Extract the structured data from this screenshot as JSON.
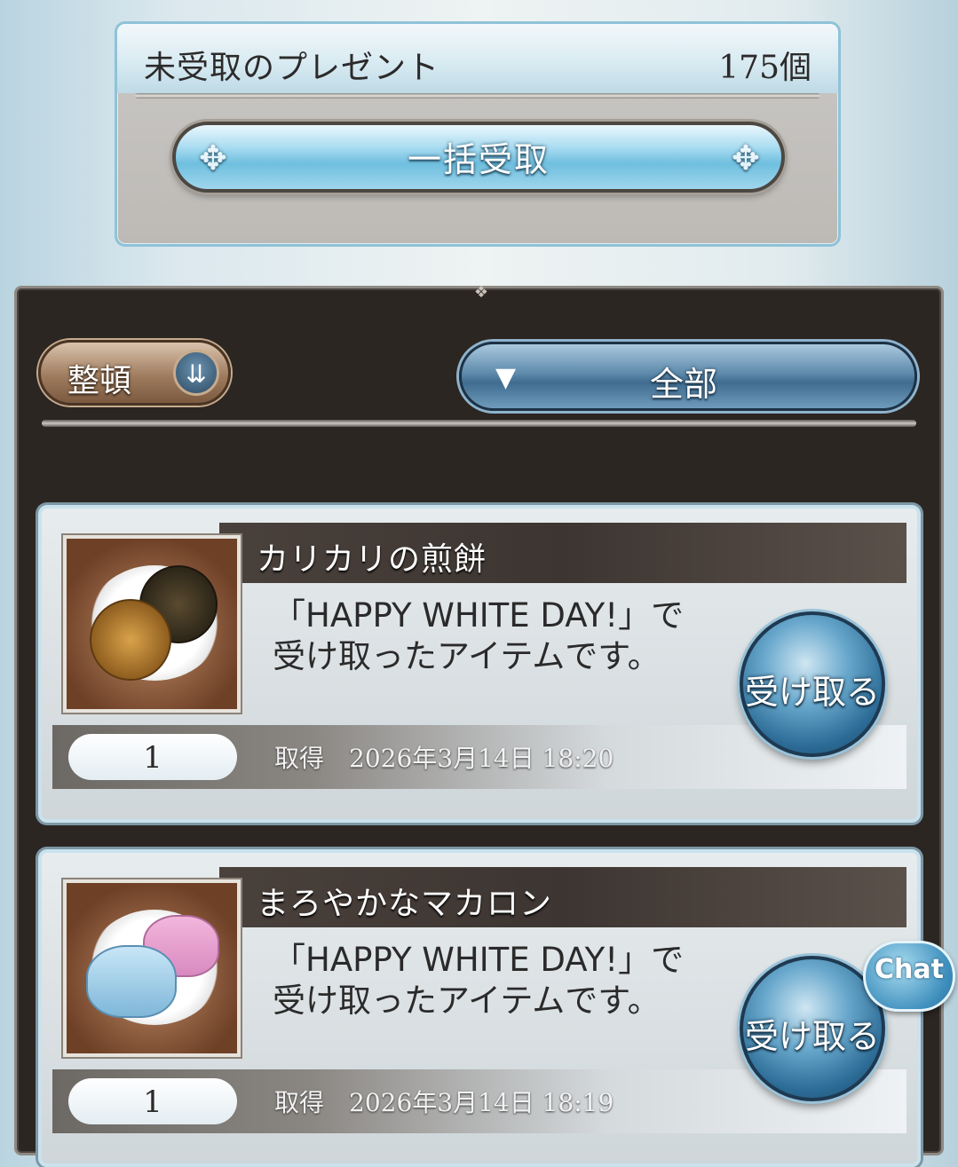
{
  "present_header": {
    "title": "未受取のプレゼント",
    "count": "175個",
    "claim_all_label": "一括受取"
  },
  "list_controls": {
    "sort_label": "整頓",
    "filter_label": "全部"
  },
  "items": [
    {
      "name": "カリカリの煎餅",
      "description": "「HAPPY WHITE DAY!」で受け取ったアイテムです。",
      "quantity": "1",
      "acquired_label": "取得",
      "acquired_date": "2026年3月14日 18:20",
      "receive_label": "受け取る"
    },
    {
      "name": "まろやかなマカロン",
      "description": "「HAPPY WHITE DAY!」で受け取ったアイテムです。",
      "quantity": "1",
      "acquired_label": "取得",
      "acquired_date": "2026年3月14日 18:19",
      "receive_label": "受け取る"
    }
  ],
  "chat": {
    "label": "Chat"
  },
  "colors": {
    "accent_blue": "#6fbfdf",
    "panel_dark": "#2b2622",
    "sort_bronze": "#a07c5e"
  }
}
